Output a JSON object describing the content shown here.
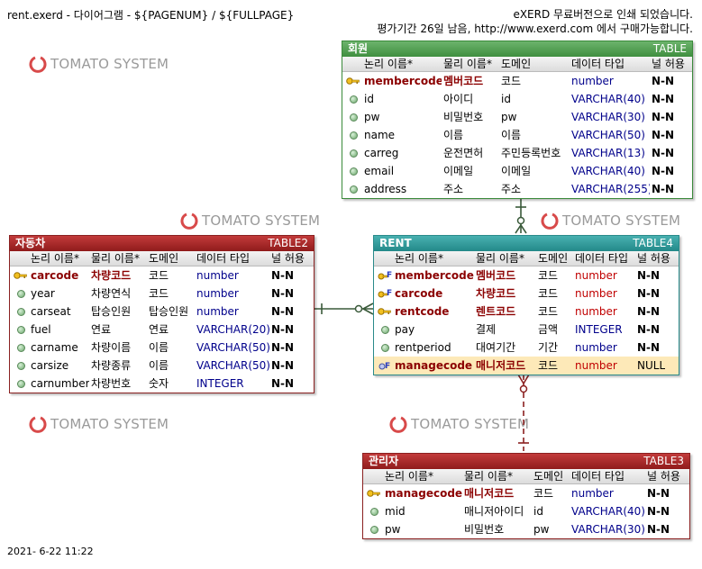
{
  "header": {
    "left": "rent.exerd - 다이어그램 - ${PAGENUM} / ${FULLPAGE}",
    "right_line1": "eXERD 무료버전으로 인쇄 되었습니다.",
    "right_line2": "평가기간 26일 남음, http://www.exerd.com 에서 구매가능합니다."
  },
  "footer": {
    "timestamp": "2021- 6-22 11:22"
  },
  "watermark": {
    "text": "TOMATO SYSTEM",
    "color": "#d84a4a"
  },
  "columns": {
    "logical": "논리 이름*",
    "physical": "물리 이름*",
    "domain": "도메인",
    "datatype": "데이터 타입",
    "nullable": "널 허용"
  },
  "tables": {
    "member": {
      "name": "회원",
      "label": "TABLE",
      "rows": [
        {
          "icon": "pk-key-icon",
          "logical": "membercode",
          "physical": "멤버코드",
          "domain": "코드",
          "type": "number",
          "null": "N-N"
        },
        {
          "icon": "column-dot-icon",
          "logical": "id",
          "physical": "아이디",
          "domain": "id",
          "type": "VARCHAR(40)",
          "null": "N-N"
        },
        {
          "icon": "column-dot-icon",
          "logical": "pw",
          "physical": "비밀번호",
          "domain": "pw",
          "type": "VARCHAR(30)",
          "null": "N-N"
        },
        {
          "icon": "column-dot-icon",
          "logical": "name",
          "physical": "이름",
          "domain": "이름",
          "type": "VARCHAR(50)",
          "null": "N-N"
        },
        {
          "icon": "column-dot-icon",
          "logical": "carreg",
          "physical": "운전면허",
          "domain": "주민등록번호",
          "type": "VARCHAR(13)",
          "null": "N-N"
        },
        {
          "icon": "column-dot-icon",
          "logical": "email",
          "physical": "이메일",
          "domain": "이메일",
          "type": "VARCHAR(40)",
          "null": "N-N"
        },
        {
          "icon": "column-dot-icon",
          "logical": "address",
          "physical": "주소",
          "domain": "주소",
          "type": "VARCHAR(255)",
          "null": "N-N"
        }
      ]
    },
    "car": {
      "name": "자동차",
      "label": "TABLE2",
      "rows": [
        {
          "icon": "pk-key-icon",
          "logical": "carcode",
          "physical": "차량코드",
          "domain": "코드",
          "type": "number",
          "null": "N-N"
        },
        {
          "icon": "column-dot-icon",
          "logical": "year",
          "physical": "차량연식",
          "domain": "코드",
          "type": "number",
          "null": "N-N"
        },
        {
          "icon": "column-dot-icon",
          "logical": "carseat",
          "physical": "탑승인원",
          "domain": "탑승인원",
          "type": "number",
          "null": "N-N"
        },
        {
          "icon": "column-dot-icon",
          "logical": "fuel",
          "physical": "연료",
          "domain": "연료",
          "type": "VARCHAR(20)",
          "null": "N-N"
        },
        {
          "icon": "column-dot-icon",
          "logical": "carname",
          "physical": "차량이름",
          "domain": "이름",
          "type": "VARCHAR(50)",
          "null": "N-N"
        },
        {
          "icon": "column-dot-icon",
          "logical": "carsize",
          "physical": "차량종류",
          "domain": "이름",
          "type": "VARCHAR(50)",
          "null": "N-N"
        },
        {
          "icon": "column-dot-icon",
          "logical": "carnumber",
          "physical": "차량번호",
          "domain": "숫자",
          "type": "INTEGER",
          "null": "N-N"
        }
      ]
    },
    "rent": {
      "name": "RENT",
      "label": "TABLE4",
      "rows": [
        {
          "icon": "pk-fk-key-icon",
          "logical": "membercode",
          "physical": "멤버코드",
          "domain": "코드",
          "type": "number",
          "null": "N-N"
        },
        {
          "icon": "pk-fk-key-icon",
          "logical": "carcode",
          "physical": "차량코드",
          "domain": "코드",
          "type": "number",
          "null": "N-N"
        },
        {
          "icon": "pk-key-icon",
          "logical": "rentcode",
          "physical": "렌트코드",
          "domain": "코드",
          "type": "number",
          "null": "N-N"
        },
        {
          "icon": "column-dot-icon",
          "logical": "pay",
          "physical": "결제",
          "domain": "금액",
          "type": "INTEGER",
          "null": "N-N"
        },
        {
          "icon": "column-dot-icon",
          "logical": "rentperiod",
          "physical": "대여기간",
          "domain": "기간",
          "type": "number",
          "null": "N-N"
        },
        {
          "icon": "fk-icon",
          "logical": "managecode",
          "physical": "매니저코드",
          "domain": "코드",
          "type": "number",
          "null": "NULL"
        }
      ]
    },
    "manager": {
      "name": "관리자",
      "label": "TABLE3",
      "rows": [
        {
          "icon": "pk-key-icon",
          "logical": "managecode",
          "physical": "매니저코드",
          "domain": "코드",
          "type": "number",
          "null": "N-N"
        },
        {
          "icon": "column-dot-icon",
          "logical": "mid",
          "physical": "매니저아이디",
          "domain": "id",
          "type": "VARCHAR(40)",
          "null": "N-N"
        },
        {
          "icon": "column-dot-icon",
          "logical": "pw",
          "physical": "비밀번호",
          "domain": "pw",
          "type": "VARCHAR(30)",
          "null": "N-N"
        }
      ]
    }
  }
}
